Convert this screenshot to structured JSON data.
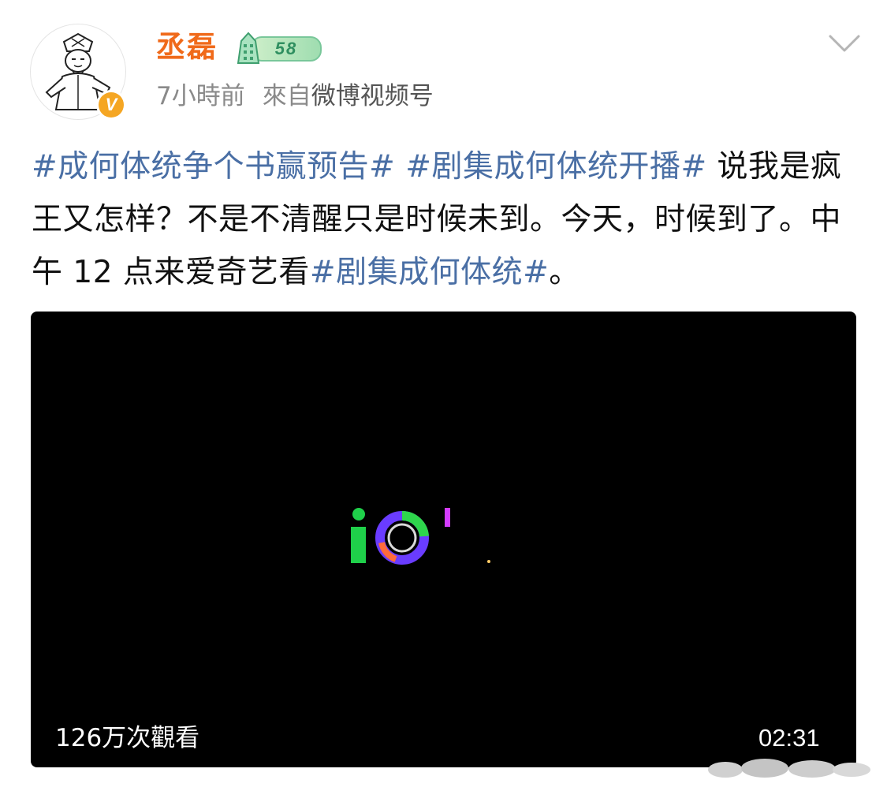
{
  "post": {
    "author": {
      "name": "丞磊",
      "level": "58",
      "verified_icon": "orange-v-verified-icon",
      "avatar_icon": "cartoon-scholar-avatar"
    },
    "meta": {
      "time": "7小時前",
      "source_prefix": "來自",
      "source_name": "微博视频号"
    },
    "text": {
      "tag1": "#成何体统争个书赢预告#",
      "tag2": "#剧集成何体统开播#",
      "body": " 说我是疯王又怎样？不是不清醒只是时候未到。今天，时候到了。中午 12 点来爱奇艺看",
      "tag3": "#剧集成何体统#",
      "end": "。"
    },
    "video": {
      "views": "126万次觀看",
      "duration": "02:31"
    }
  },
  "colors": {
    "username": "#f06a1a",
    "topic_link": "#4a6fa5",
    "meta_gray": "#8a8a8a",
    "video_bg": "#000000",
    "iqiyi_green": "#1fd04a"
  }
}
